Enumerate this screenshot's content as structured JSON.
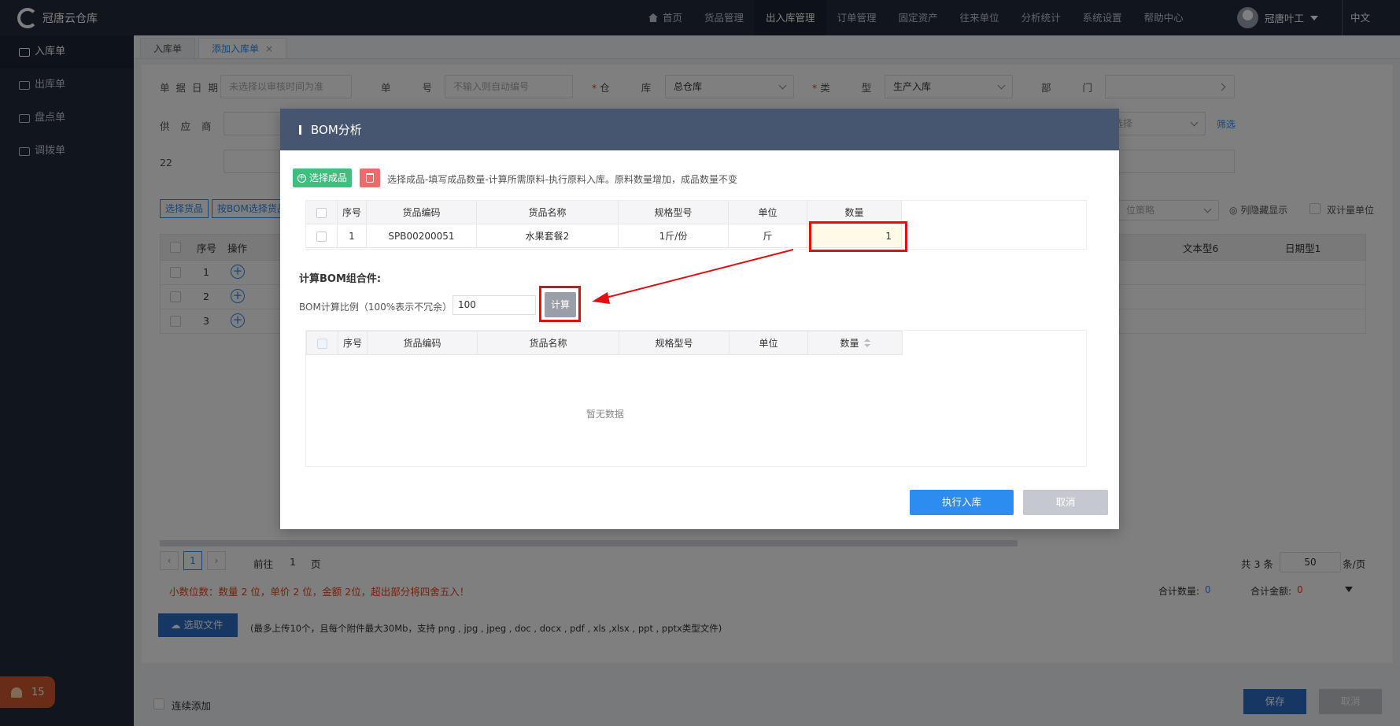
{
  "app": {
    "name": "冠唐云仓库"
  },
  "nav": [
    "首页",
    "货品管理",
    "出入库管理",
    "订单管理",
    "固定资产",
    "往来单位",
    "分析统计",
    "系统设置",
    "帮助中心"
  ],
  "user": {
    "name": "冠唐叶工",
    "lang": "中文"
  },
  "sidebar": [
    "入库单",
    "出库单",
    "盘点单",
    "调拨单"
  ],
  "alerts": {
    "count": "15"
  },
  "tabs": [
    {
      "label": "入库单"
    },
    {
      "label": "添加入库单",
      "close": "×"
    }
  ],
  "form": {
    "date_label": "单据日期",
    "date_placeholder": "未选择以审核时间为准",
    "no_label": "单号",
    "no_placeholder": "不输入则自动编号",
    "warehouse_label": "仓库",
    "warehouse_value": "总仓库",
    "type_label": "类型",
    "type_value": "生产入库",
    "dept_label": "部门",
    "supplier_label": "供应商",
    "select_placeholder": "选择",
    "filter_link": "筛选",
    "field22_label": "22"
  },
  "toolbar": {
    "select_goods": "选择货品",
    "by_bom": "按BOM选择货品",
    "strategy_placeholder": "位策略",
    "hide_columns": "列隐藏显示",
    "dual_unit": "双计量单位"
  },
  "bg_table": {
    "headers": {
      "seq": "序号",
      "op": "操作",
      "text6": "文本型6",
      "date1": "日期型1"
    },
    "rows": [
      "1",
      "2",
      "3"
    ]
  },
  "pager": {
    "current": "1",
    "goto_label": "前往",
    "goto_value": "1",
    "page_unit": "页",
    "total": "共 3 条",
    "page_size": "50",
    "per_page": "条/页"
  },
  "notice": {
    "decimals": "小数位数：数量 2 位，单价 2 位，金额 2位，超出部分将四舍五入！"
  },
  "totals": {
    "qty_label": "合计数量:",
    "qty_value": "0",
    "amount_label": "合计金额:",
    "amount_value": "0"
  },
  "upload": {
    "button": "选取文件",
    "hint": "(最多上传10个，且每个附件最大30Mb，支持 png , jpg , jpeg , doc , docx , pdf , xls ,xlsx , ppt , pptx类型文件)"
  },
  "footer": {
    "continuous_add": "连续添加",
    "save": "保存",
    "cancel": "取消"
  },
  "modal": {
    "title": "BOM分析",
    "select_product": "选择成品",
    "hint": "选择成品-填写成品数量-计算所需原料-执行原料入库。原料数量增加，成品数量不变",
    "headers": [
      "序号",
      "货品编码",
      "货品名称",
      "规格型号",
      "单位",
      "数量"
    ],
    "products": [
      {
        "seq": "1",
        "code": "SPB00200051",
        "name": "水果套餐2",
        "spec": "1斤/份",
        "unit": "斤",
        "qty": "1"
      }
    ],
    "section_title": "计算BOM组合件:",
    "ratio_label": "BOM计算比例（100%表示不冗余）",
    "ratio_value": "100",
    "calc_button": "计算",
    "empty_text": "暂无数据",
    "execute_button": "执行入库",
    "cancel_button": "取消"
  },
  "colors": {
    "topbar": "#222c3c",
    "accent": "#2d8cf0",
    "modal_header": "#475670",
    "highlight": "#e01010"
  }
}
